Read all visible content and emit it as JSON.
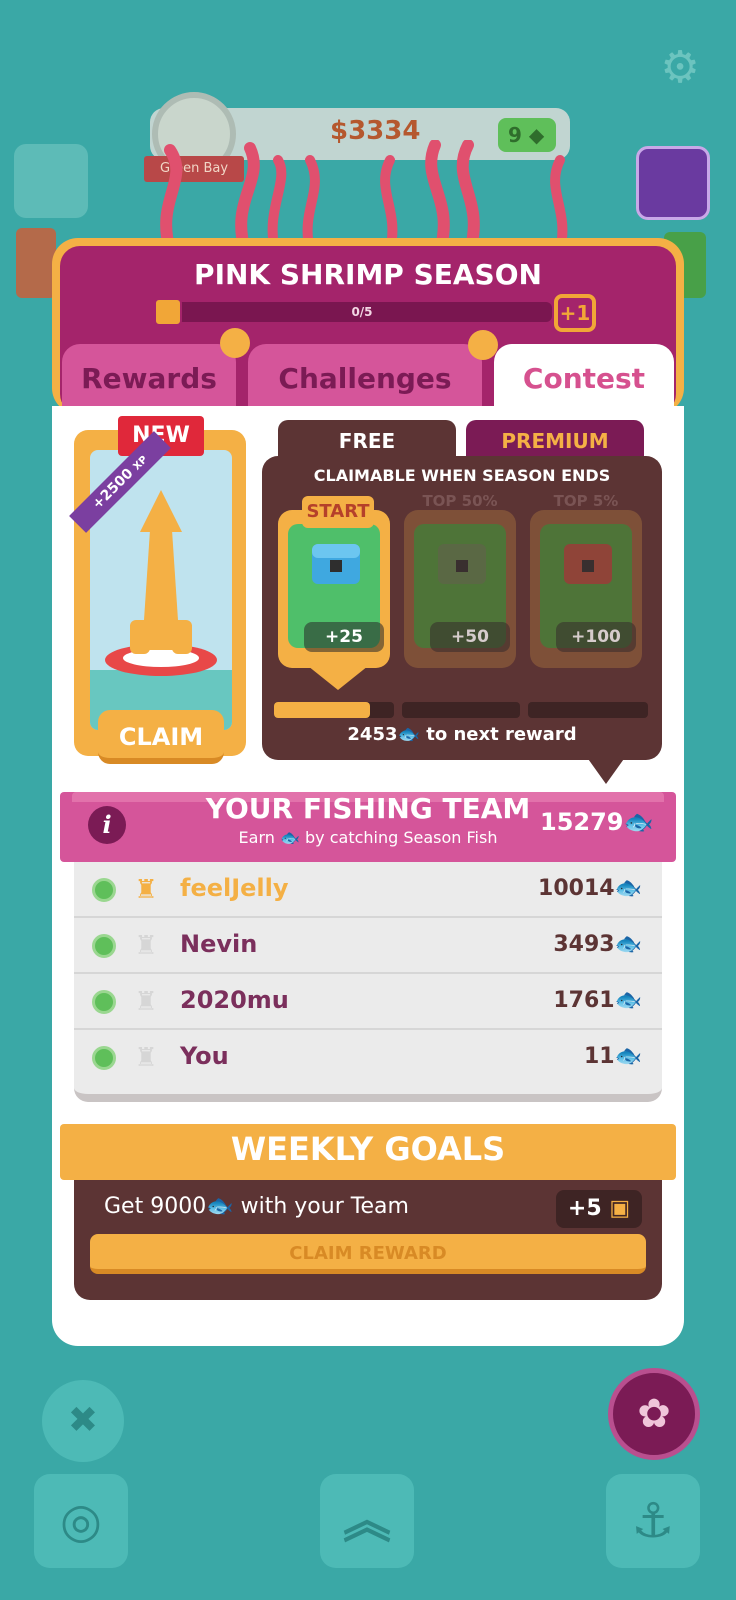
{
  "hud": {
    "money": "$3334",
    "gems": "9",
    "location": "Green Bay"
  },
  "season": {
    "title": "PINK SHRIMP SEASON",
    "progress_text": "0/5",
    "progress_fraction": 0,
    "plus_badge": "+1"
  },
  "tabs": [
    {
      "label": "Rewards"
    },
    {
      "label": "Challenges"
    },
    {
      "label": "Contest"
    }
  ],
  "reward_card": {
    "badge": "NEW",
    "xp": "+2500",
    "xp_unit": "XP",
    "claim_label": "CLAIM"
  },
  "contest": {
    "free_label": "FREE",
    "premium_label": "PREMIUM",
    "claimable_text": "CLAIMABLE WHEN SEASON ENDS",
    "tiers": [
      {
        "label": "START",
        "amount": "+25"
      },
      {
        "label": "TOP 50%",
        "amount": "+50"
      },
      {
        "label": "TOP 5%",
        "amount": "+100"
      }
    ],
    "progress_fraction": 0.8,
    "next_reward_value": "2453",
    "next_reward_text": "to next reward"
  },
  "team": {
    "title": "YOUR FISHING TEAM",
    "subtitle_prefix": "Earn",
    "subtitle_suffix": "by catching Season Fish",
    "total": "15279",
    "info_icon": "i",
    "members": [
      {
        "name": "feelJelly",
        "score": "10014"
      },
      {
        "name": "Nevin",
        "score": "3493"
      },
      {
        "name": "2020mu",
        "score": "1761"
      },
      {
        "name": "You",
        "score": "11"
      }
    ]
  },
  "weekly_goals": {
    "title": "WEEKLY GOALS",
    "goal_prefix": "Get 9000",
    "goal_suffix": "with your Team",
    "reward": "+5",
    "claim_label": "CLAIM REWARD"
  },
  "colors": {
    "background": "#3aa8a6",
    "season_purple": "#a4246b",
    "pink": "#d5559a",
    "orange": "#f4b045",
    "brown": "#5c3434"
  },
  "icons": [
    "gear-icon",
    "captain-icon",
    "wizard-icon",
    "gem-icon",
    "fish-icon",
    "map-icon",
    "compass-icon",
    "upgrade-chevrons-icon",
    "anchor-icon",
    "season-badge-icon"
  ]
}
